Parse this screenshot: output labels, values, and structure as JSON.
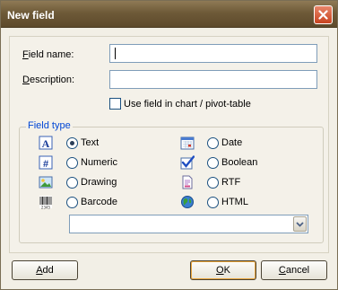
{
  "window": {
    "title": "New field"
  },
  "form": {
    "field_name_label_u": "F",
    "field_name_label_rest": "ield name:",
    "field_name_value": "",
    "description_label_u": "D",
    "description_label_rest": "escription:",
    "description_value": "",
    "chart_checkbox_label": "Use field in chart / pivot-table",
    "chart_checkbox_checked": false
  },
  "field_type": {
    "legend": "Field type",
    "left": [
      {
        "label": "Text",
        "icon": "text-a-icon",
        "checked": true
      },
      {
        "label": "Numeric",
        "icon": "hash-icon",
        "checked": false
      },
      {
        "label": "Drawing",
        "icon": "picture-icon",
        "checked": false
      },
      {
        "label": "Barcode",
        "icon": "barcode-icon",
        "checked": false
      }
    ],
    "right": [
      {
        "label": "Date",
        "icon": "calendar-icon",
        "checked": false
      },
      {
        "label": "Boolean",
        "icon": "checkmark-icon",
        "checked": false
      },
      {
        "label": "RTF",
        "icon": "rtf-document-icon",
        "checked": false
      },
      {
        "label": "HTML",
        "icon": "globe-icon",
        "checked": false
      }
    ],
    "combo_value": ""
  },
  "buttons": {
    "add_u": "A",
    "add_rest": "dd",
    "ok_u": "O",
    "ok_rest": "K",
    "cancel_u": "C",
    "cancel_rest": "ancel"
  }
}
